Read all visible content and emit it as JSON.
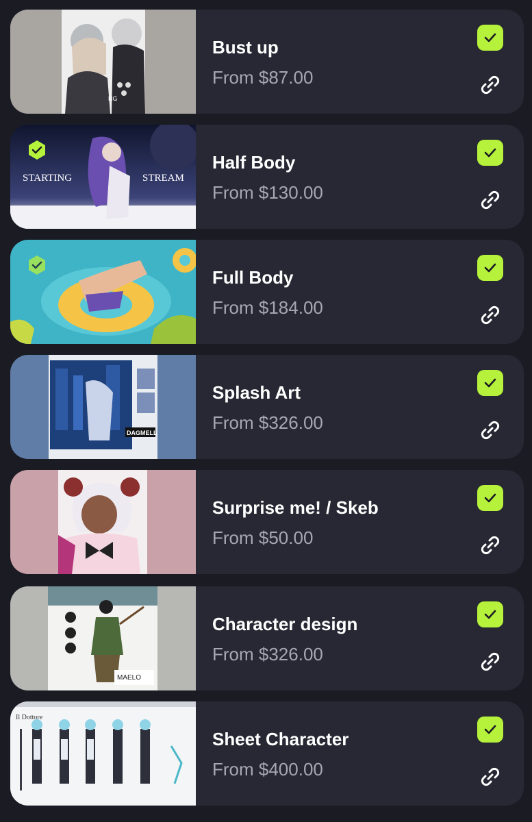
{
  "items": [
    {
      "title": "Bust up",
      "price": "From $87.00"
    },
    {
      "title": "Half Body",
      "price": "From $130.00"
    },
    {
      "title": "Full Body",
      "price": "From $184.00"
    },
    {
      "title": "Splash Art",
      "price": "From $326.00"
    },
    {
      "title": "Surprise me! / Skeb",
      "price": "From $50.00"
    },
    {
      "title": "Character design",
      "price": "From $326.00"
    },
    {
      "title": "Sheet Character",
      "price": "From $400.00"
    }
  ],
  "thumb_text": {
    "stream_left": "STARTING",
    "stream_right": "STREAM",
    "splash_label": "DAGMELL",
    "design_label": "MAELO",
    "sheet_label": "Il Dottore",
    "bust_label": "NG"
  },
  "colors": {
    "background": "#1a1b23",
    "card": "#272833",
    "accent_check": "#b6f13c",
    "title": "#ffffff",
    "price": "#a6a7b2"
  },
  "icons": {
    "status": "check-icon",
    "share": "link-icon",
    "badge": "verified-badge-icon"
  }
}
